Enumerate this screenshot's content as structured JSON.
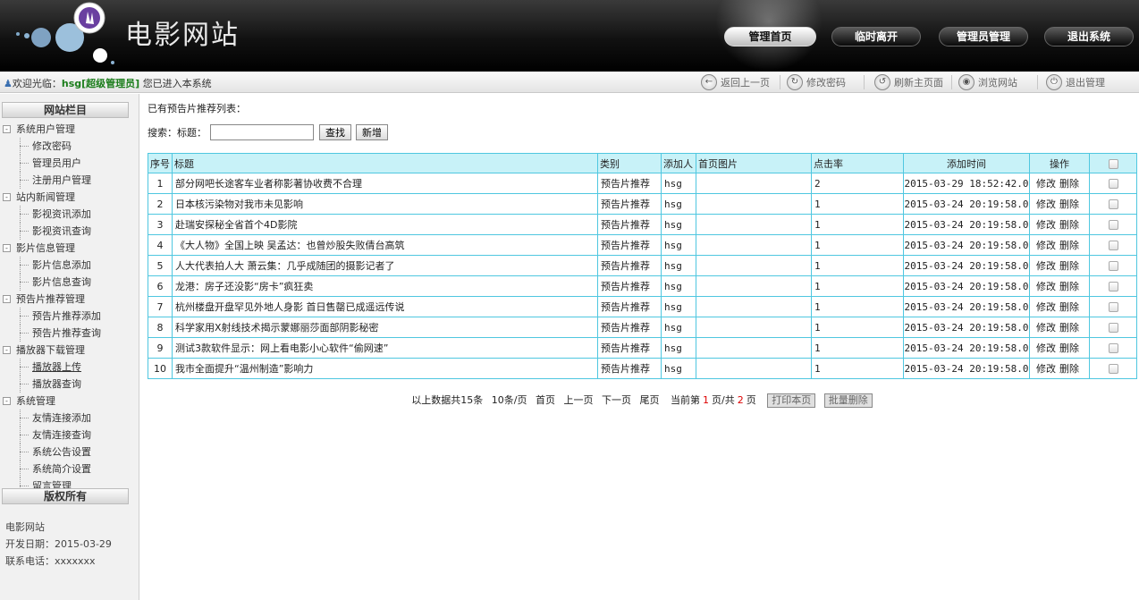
{
  "header": {
    "site_title": "电影网站",
    "nav": [
      {
        "label": "管理首页",
        "active": true
      },
      {
        "label": "临时离开"
      },
      {
        "label": "管理员管理"
      },
      {
        "label": "退出系统"
      }
    ]
  },
  "toolbar": {
    "welcome_prefix": "欢迎光临：",
    "username": "hsg[超级管理员]",
    "welcome_suffix": "您已进入本系统",
    "buttons": [
      {
        "label": "返回上一页",
        "icon": "back-arrow-icon"
      },
      {
        "label": "修改密码",
        "icon": "password-icon"
      },
      {
        "label": "刷新主页面",
        "icon": "refresh-icon"
      },
      {
        "label": "浏览网站",
        "icon": "browse-icon"
      },
      {
        "label": "退出管理",
        "icon": "power-icon"
      }
    ]
  },
  "sidebar": {
    "heading": "网站栏目",
    "groups": [
      {
        "label": "系统用户管理",
        "items": [
          "修改密码",
          "管理员用户",
          "注册用户管理"
        ]
      },
      {
        "label": "站内新闻管理",
        "items": [
          "影视资讯添加",
          "影视资讯查询"
        ]
      },
      {
        "label": "影片信息管理",
        "items": [
          "影片信息添加",
          "影片信息查询"
        ]
      },
      {
        "label": "预告片推荐管理",
        "items": [
          "预告片推荐添加",
          "预告片推荐查询"
        ]
      },
      {
        "label": "播放器下载管理",
        "items": [
          "播放器上传",
          "播放器查询"
        ]
      },
      {
        "label": "系统管理",
        "items": [
          "友情连接添加",
          "友情连接查询",
          "系统公告设置",
          "系统简介设置",
          "留言管理"
        ]
      }
    ],
    "copyright_heading": "版权所有",
    "footer": {
      "site": "电影网站",
      "dev_date": "开发日期：2015-03-29",
      "phone": "联系电话：xxxxxxx"
    }
  },
  "main": {
    "list_title": "已有预告片推荐列表：",
    "search": {
      "label": "搜索：标题：",
      "value": "",
      "search_button": "查找",
      "add_button": "新增"
    },
    "columns": [
      "序号",
      "标题",
      "类别",
      "添加人",
      "首页图片",
      "点击率",
      "添加时间",
      "操作"
    ],
    "rows": [
      {
        "no": "1",
        "title": "部分网吧长途客车业者称影著协收费不合理",
        "category": "预告片推荐",
        "adder": "hsg",
        "image": "",
        "clicks": "2",
        "time": "2015-03-29 18:52:42.0"
      },
      {
        "no": "2",
        "title": "日本核污染物对我市未见影响",
        "category": "预告片推荐",
        "adder": "hsg",
        "image": "",
        "clicks": "1",
        "time": "2015-03-24 20:19:58.0"
      },
      {
        "no": "3",
        "title": "赴瑞安探秘全省首个4D影院",
        "category": "预告片推荐",
        "adder": "hsg",
        "image": "",
        "clicks": "1",
        "time": "2015-03-24 20:19:58.0"
      },
      {
        "no": "4",
        "title": "《大人物》全国上映 吴孟达：也曾炒股失败倩台高筑",
        "category": "预告片推荐",
        "adder": "hsg",
        "image": "",
        "clicks": "1",
        "time": "2015-03-24 20:19:58.0"
      },
      {
        "no": "5",
        "title": "人大代表拍人大 萧云集：几乎成随团的摄影记者了",
        "category": "预告片推荐",
        "adder": "hsg",
        "image": "",
        "clicks": "1",
        "time": "2015-03-24 20:19:58.0"
      },
      {
        "no": "6",
        "title": "龙港：房子还没影“房卡”疯狂卖",
        "category": "预告片推荐",
        "adder": "hsg",
        "image": "",
        "clicks": "1",
        "time": "2015-03-24 20:19:58.0"
      },
      {
        "no": "7",
        "title": "杭州楼盘开盘罕见外地人身影 首日售罄已成遥远传说",
        "category": "预告片推荐",
        "adder": "hsg",
        "image": "",
        "clicks": "1",
        "time": "2015-03-24 20:19:58.0"
      },
      {
        "no": "8",
        "title": "科学家用X射线技术揭示蒙娜丽莎面部阴影秘密",
        "category": "预告片推荐",
        "adder": "hsg",
        "image": "",
        "clicks": "1",
        "time": "2015-03-24 20:19:58.0"
      },
      {
        "no": "9",
        "title": "测试3款软件显示：网上看电影小心软件“偷网速”",
        "category": "预告片推荐",
        "adder": "hsg",
        "image": "",
        "clicks": "1",
        "time": "2015-03-24 20:19:58.0"
      },
      {
        "no": "10",
        "title": "我市全面提升“温州制造”影响力",
        "category": "预告片推荐",
        "adder": "hsg",
        "image": "",
        "clicks": "1",
        "time": "2015-03-24 20:19:58.0"
      }
    ],
    "row_actions": {
      "edit": "修改",
      "delete": "删除"
    },
    "pager": {
      "total": "以上数据共15条",
      "per_page": "10条/页",
      "first": "首页",
      "prev": "上一页",
      "next": "下一页",
      "last": "尾页",
      "current_prefix": "当前第",
      "current_page": "1",
      "current_mid": "页/共",
      "total_pages": "2",
      "current_suffix": "页",
      "print_button": "打印本页",
      "batch_delete_button": "批量删除"
    }
  }
}
